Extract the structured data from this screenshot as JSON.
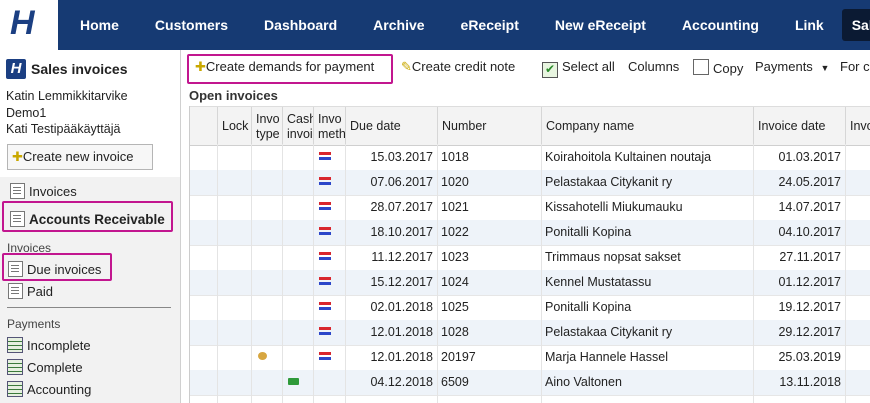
{
  "nav": {
    "items": [
      "Home",
      "Customers",
      "Dashboard",
      "Archive",
      "eReceipt",
      "New eReceipt",
      "Accounting",
      "Link",
      "Sales i"
    ]
  },
  "sidebar": {
    "title": "Sales invoices",
    "company": "Katin Lemmikkitarvike",
    "environment": "Demo1",
    "user": "Kati Testipääkäyttäjä",
    "new_invoice_label": "Create new invoice",
    "invoices_link": "Invoices",
    "accounts_receivable": "Accounts Receivable",
    "invoices_section": "Invoices",
    "due_invoices": "Due invoices",
    "paid": "Paid",
    "payments_section": "Payments",
    "incomplete": "Incomplete",
    "complete": "Complete",
    "accounting": "Accounting"
  },
  "toolbar": {
    "create_demands": "Create demands for payment",
    "create_credit": "Create credit note",
    "select_all": "Select all",
    "columns": "Columns",
    "copy": "Copy",
    "payments": "Payments",
    "more": "For c"
  },
  "grid": {
    "title": "Open invoices",
    "headers": {
      "lock": "Lock",
      "invoice_type": "Invo type",
      "cash_invoice": "Cash invoi",
      "invoice_method": "Invo meth",
      "due_date": "Due date",
      "number": "Number",
      "company": "Company name",
      "invoice_date": "Invoice date",
      "more": "Invo"
    },
    "rows": [
      {
        "due": "15.03.2017",
        "number": "1018",
        "company": "Koirahoitola Kultainen noutaja",
        "date": "01.03.2017"
      },
      {
        "due": "07.06.2017",
        "number": "1020",
        "company": "Pelastakaa Citykanit ry",
        "date": "24.05.2017"
      },
      {
        "due": "28.07.2017",
        "number": "1021",
        "company": "Kissahotelli Miukumauku",
        "date": "14.07.2017"
      },
      {
        "due": "18.10.2017",
        "number": "1022",
        "company": "Ponitalli Kopina",
        "date": "04.10.2017"
      },
      {
        "due": "11.12.2017",
        "number": "1023",
        "company": "Trimmaus nopsat sakset",
        "date": "27.11.2017"
      },
      {
        "due": "15.12.2017",
        "number": "1024",
        "company": "Kennel Mustatassu",
        "date": "01.12.2017"
      },
      {
        "due": "02.01.2018",
        "number": "1025",
        "company": "Ponitalli Kopina",
        "date": "19.12.2017"
      },
      {
        "due": "12.01.2018",
        "number": "1028",
        "company": "Pelastakaa Citykanit ry",
        "date": "29.12.2017"
      },
      {
        "due": "12.01.2018",
        "number": "20197",
        "company": "Marja Hannele Hassel",
        "date": "25.03.2019"
      },
      {
        "due": "04.12.2018",
        "number": "6509",
        "company": "Aino Valtonen",
        "date": "13.11.2018"
      }
    ]
  },
  "colors": {
    "nav_bg": "#163a73",
    "highlight": "#c2168f",
    "row_alt": "#eef3f9"
  },
  "icons": [
    "logo-h-icon",
    "star-icon",
    "doc-list-icon",
    "grid-icon",
    "checkbox-icon",
    "copy-icon",
    "chevron-down-icon",
    "transfer-arrows-icon",
    "coin-icon",
    "cash-icon"
  ]
}
